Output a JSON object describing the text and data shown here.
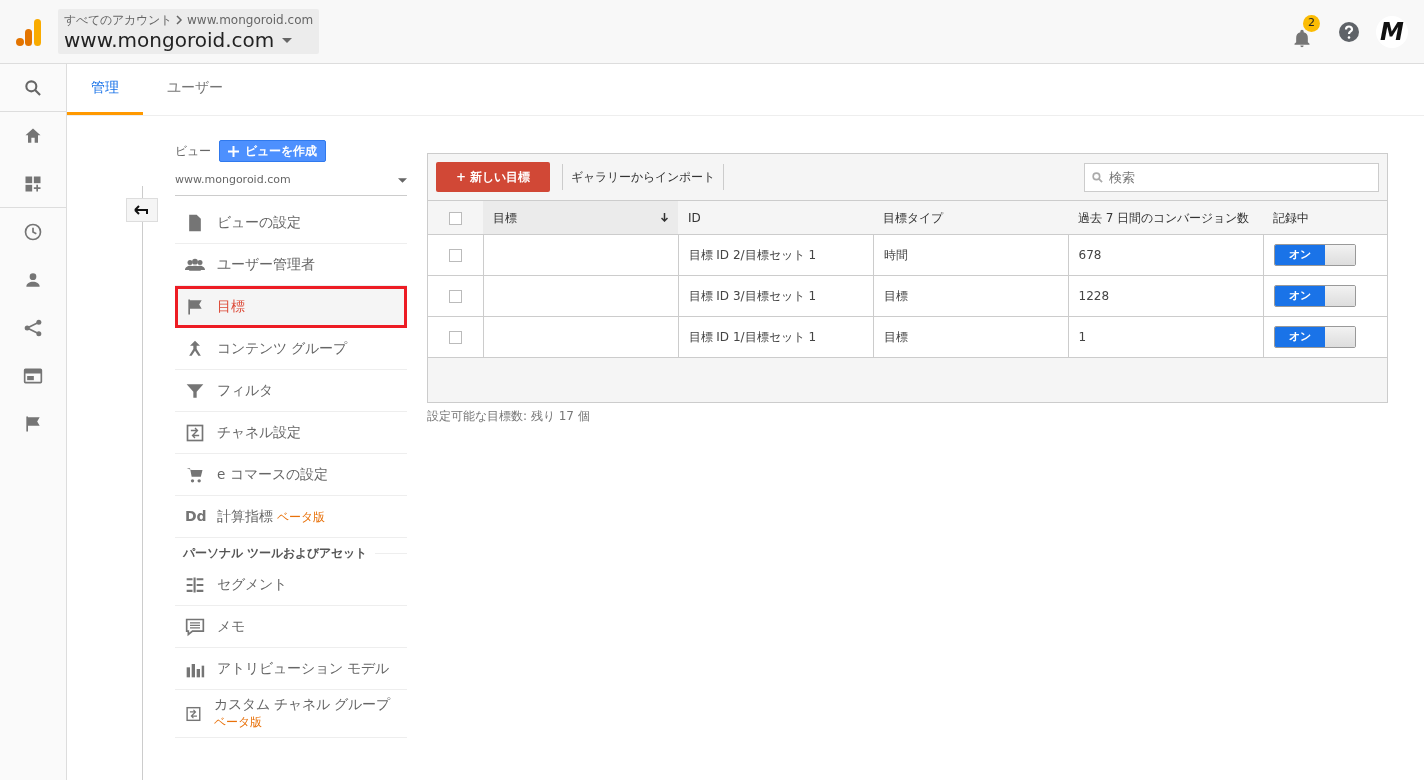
{
  "header": {
    "breadcrumb": "すべてのアカウント",
    "breadcrumb_property": "www.mongoroid.com",
    "property": "www.mongoroid.com",
    "notifications": "2",
    "avatar": "M"
  },
  "rail": [
    {
      "kind": "search",
      "divider": true
    },
    {
      "kind": "home",
      "divider": false
    },
    {
      "kind": "customize",
      "divider": true
    },
    {
      "kind": "clock",
      "divider": false
    },
    {
      "kind": "person",
      "divider": false
    },
    {
      "kind": "acquisition",
      "divider": false
    },
    {
      "kind": "behavior",
      "divider": false
    },
    {
      "kind": "flag",
      "divider": false
    }
  ],
  "tabs": [
    {
      "label": "管理",
      "selected": true
    },
    {
      "label": "ユーザー",
      "selected": false
    }
  ],
  "view": {
    "label": "ビュー",
    "create_button": "ビューを作成",
    "selector": "www.mongoroid.com"
  },
  "menu": [
    {
      "kind": "doc",
      "label": "ビューの設定",
      "selected": false,
      "outlined": false
    },
    {
      "kind": "people",
      "label": "ユーザー管理者",
      "selected": false,
      "outlined": false
    },
    {
      "kind": "flag",
      "label": "目標",
      "selected": true,
      "outlined": true
    },
    {
      "kind": "merge",
      "label": "コンテンツ グループ",
      "selected": false,
      "outlined": false
    },
    {
      "kind": "filter",
      "label": "フィルタ",
      "selected": false,
      "outlined": false
    },
    {
      "kind": "channel",
      "label": "チャネル設定",
      "selected": false,
      "outlined": false
    },
    {
      "kind": "cart",
      "label": "e コマースの設定",
      "selected": false,
      "outlined": false
    },
    {
      "kind": "dd",
      "icon_text": "Dd",
      "label": "計算指標",
      "badge": "ベータ版",
      "selected": false,
      "outlined": false
    },
    {
      "kind": "heading",
      "label": "パーソナル ツールおよびアセット"
    },
    {
      "kind": "segment",
      "label": "セグメント",
      "selected": false,
      "outlined": false
    },
    {
      "kind": "memo",
      "label": "メモ",
      "selected": false,
      "outlined": false
    },
    {
      "kind": "bars",
      "label": "アトリビューション モデル",
      "selected": false,
      "outlined": false
    },
    {
      "kind": "channel",
      "label": "カスタム チャネル グループ",
      "badge": "ベータ版",
      "selected": false,
      "outlined": false
    }
  ],
  "toolbar": {
    "new_button": "+ 新しい目標",
    "import_button": "ギャラリーからインポート",
    "search": {
      "placeholder": "検索"
    }
  },
  "table": {
    "header_checkbox": {
      "checked": false
    },
    "columns": [
      {
        "label": "目標",
        "sorted": true
      },
      {
        "label": "ID",
        "sorted": false
      },
      {
        "label": "目標タイプ",
        "sorted": false
      },
      {
        "label": "過去 7 日間のコンバージョン数",
        "sorted": false
      },
      {
        "label": "記録中",
        "sorted": false
      }
    ],
    "rows": [
      {
        "checked": false,
        "id": "目標 ID 2/目標セット 1",
        "type": "時間",
        "conversions": "678",
        "recording": {
          "on": true,
          "label": "オン"
        }
      },
      {
        "checked": false,
        "id": "目標 ID 3/目標セット 1",
        "type": "目標",
        "conversions": "1228",
        "recording": {
          "on": true,
          "label": "オン"
        }
      },
      {
        "checked": false,
        "id": "目標 ID 1/目標セット 1",
        "type": "目標",
        "conversions": "1",
        "recording": {
          "on": true,
          "label": "オン"
        }
      }
    ]
  },
  "footer": "設定可能な目標数: 残り 17 個"
}
